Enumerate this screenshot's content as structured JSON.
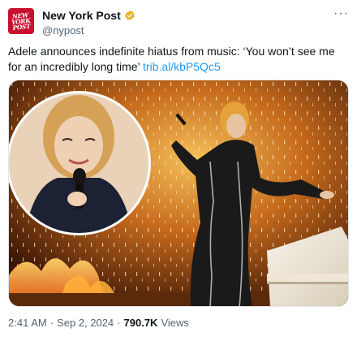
{
  "account": {
    "display_name": "New York Post",
    "handle": "@nypost",
    "logo_text_line1": "NEW",
    "logo_text_line2": "YORK",
    "logo_text_line3": "POST"
  },
  "tweet": {
    "text": "Adele announces indefinite hiatus from music: ‘You won’t see me for an incredibly long time’ ",
    "link": "trib.al/kbP5Qc5"
  },
  "meta": {
    "time": "2:41 AM",
    "separator1": "·",
    "date": "Sep 2, 2024",
    "separator2": "·",
    "views_count": "790.7K",
    "views_label": "Views"
  },
  "colors": {
    "brand_red": "#c8102e",
    "link_blue": "#1d9bf0",
    "verified_gold": "#e8b321"
  }
}
